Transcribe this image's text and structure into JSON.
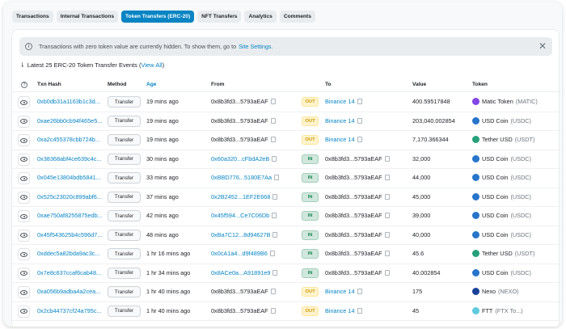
{
  "tabs": [
    "Transactions",
    "Internal Transactions",
    "Token Transfers (ERC-20)",
    "NFT Transfers",
    "Analytics",
    "Comments"
  ],
  "active_tab": 2,
  "alert": {
    "text": "Transactions with zero token value are currently hidden. To show them, go to",
    "link": "Site Settings.",
    "close": "✕"
  },
  "summary": {
    "text": "Latest 25 ERC-20 Token Transfer Events (",
    "link": "View All",
    "tail": ")"
  },
  "columns": {
    "txn": "Txn Hash",
    "method": "Method",
    "age": "Age",
    "from": "From",
    "to": "To",
    "value": "Value",
    "token": "Token"
  },
  "rows": [
    {
      "hash": "0xb0db31a1163b1c3d...",
      "method": "Transfer",
      "age": "19 mins ago",
      "from": "0x8b3fd3...5793aEAF",
      "from_link": false,
      "dir": "OUT",
      "to": "Binance 14",
      "to_link": true,
      "value": "400.59517848",
      "token": "Matic Token",
      "sym": "(MATIC)",
      "color": "#8247e5"
    },
    {
      "hash": "0xae26bb0cb94f465e5...",
      "method": "Transfer",
      "age": "19 mins ago",
      "from": "0x8b3fd3...5793aEAF",
      "from_link": false,
      "dir": "OUT",
      "to": "Binance 14",
      "to_link": true,
      "value": "203,040.002854",
      "token": "USD Coin",
      "sym": "(USDC)",
      "color": "#2775ca"
    },
    {
      "hash": "0xa2c455378cbb724b...",
      "method": "Transfer",
      "age": "19 mins ago",
      "from": "0x8b3fd3...5793aEAF",
      "from_link": false,
      "dir": "OUT",
      "to": "Binance 14",
      "to_link": true,
      "value": "7,170.366344",
      "token": "Tether USD",
      "sym": "(USDT)",
      "color": "#26a17b"
    },
    {
      "hash": "0x38368abf4ce639c4c...",
      "method": "Transfer",
      "age": "30 mins ago",
      "from": "0x60a320...cFbdA2eB",
      "from_link": true,
      "dir": "IN",
      "to": "0x8b3fd3...5793aEAF",
      "to_link": false,
      "value": "32,000",
      "token": "USD Coin",
      "sym": "(USDC)",
      "color": "#2775ca"
    },
    {
      "hash": "0x045e13804bdb5841...",
      "method": "Transfer",
      "age": "33 mins ago",
      "from": "0xBBD776...5180E7Aa",
      "from_link": true,
      "dir": "IN",
      "to": "0x8b3fd3...5793aEAF",
      "to_link": false,
      "value": "44,000",
      "token": "USD Coin",
      "sym": "(USDC)",
      "color": "#2775ca"
    },
    {
      "hash": "0x525c23020c899abf6...",
      "method": "Transfer",
      "age": "37 mins ago",
      "from": "0x2B2452...1EF2E668",
      "from_link": true,
      "dir": "IN",
      "to": "0x8b3fd3...5793aEAF",
      "to_link": false,
      "value": "45,000",
      "token": "USD Coin",
      "sym": "(USDC)",
      "color": "#2775ca"
    },
    {
      "hash": "0xae750af8255875edb...",
      "method": "Transfer",
      "age": "42 mins ago",
      "from": "0x45f594...Ce7C06Db",
      "from_link": true,
      "dir": "IN",
      "to": "0x8b3fd3...5793aEAF",
      "to_link": false,
      "value": "39,000",
      "token": "USD Coin",
      "sym": "(USDC)",
      "color": "#2775ca"
    },
    {
      "hash": "0x45f543625b4c596d7...",
      "method": "Transfer",
      "age": "48 mins ago",
      "from": "0xBa7C12...8d94627B",
      "from_link": true,
      "dir": "IN",
      "to": "0x8b3fd3...5793aEAF",
      "to_link": false,
      "value": "40,000",
      "token": "USD Coin",
      "sym": "(USDC)",
      "color": "#2775ca"
    },
    {
      "hash": "0xddec5a82bda9ac3c...",
      "method": "Transfer",
      "age": "1 hr 16 mins ago",
      "from": "0x0cA1a4...d9f489B6",
      "from_link": true,
      "dir": "IN",
      "to": "0x8b3fd3...5793aEAF",
      "to_link": false,
      "value": "45.6",
      "token": "Tether USD",
      "sym": "(USDT)",
      "color": "#26a17b"
    },
    {
      "hash": "0x7e8c637ccaf6cab48...",
      "method": "Transfer",
      "age": "1 hr 34 mins ago",
      "from": "0x8ACe0a...A91891e9",
      "from_link": true,
      "dir": "IN",
      "to": "0x8b3fd3...5793aEAF",
      "to_link": false,
      "value": "40.002854",
      "token": "USD Coin",
      "sym": "(USDC)",
      "color": "#2775ca"
    },
    {
      "hash": "0xa056b9adba4a2cea...",
      "method": "Transfer",
      "age": "1 hr 40 mins ago",
      "from": "0x8b3fd3...5793aEAF",
      "from_link": false,
      "dir": "OUT",
      "to": "Binance 14",
      "to_link": true,
      "value": "175",
      "token": "Nexo",
      "sym": "(NEXO)",
      "color": "#1a4199"
    },
    {
      "hash": "0x2cb44737cf24a795c...",
      "method": "Transfer",
      "age": "1 hr 40 mins ago",
      "from": "0x8b3fd3...5793aEAF",
      "from_link": false,
      "dir": "OUT",
      "to": "Binance 14",
      "to_link": true,
      "value": "45",
      "token": "FTT",
      "sym": "(FTX To...)",
      "color": "#5fcade"
    }
  ]
}
